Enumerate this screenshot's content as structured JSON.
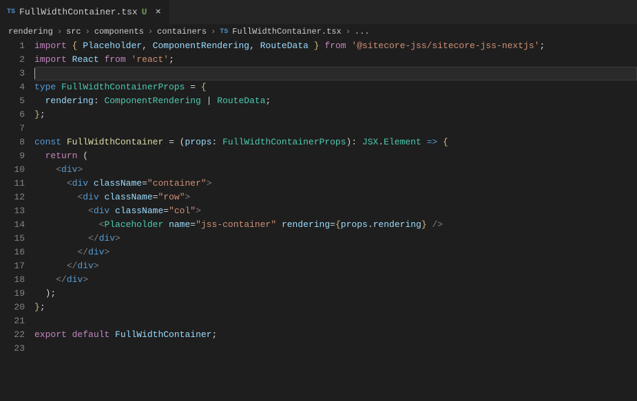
{
  "tab": {
    "icon_text": "TS",
    "filename": "FullWidthContainer.tsx",
    "modified_flag": "U"
  },
  "breadcrumbs": {
    "parts": [
      "rendering",
      "src",
      "components",
      "containers"
    ],
    "file_icon": "TS",
    "file": "FullWidthContainer.tsx",
    "trailing": "..."
  },
  "lines": {
    "nums": [
      "1",
      "2",
      "3",
      "4",
      "5",
      "6",
      "7",
      "8",
      "9",
      "10",
      "11",
      "12",
      "13",
      "14",
      "15",
      "16",
      "17",
      "18",
      "19",
      "20",
      "21",
      "22",
      "23"
    ]
  },
  "code": {
    "l1": {
      "import": "import",
      "open": "{ ",
      "a": "Placeholder",
      "c1": ", ",
      "b": "ComponentRendering",
      "c2": ", ",
      "c": "RouteData",
      "close": " }",
      "from": "from",
      "str": "'@sitecore-jss/sitecore-jss-nextjs'",
      "semi": ";"
    },
    "l2": {
      "import": "import",
      "id": "React",
      "from": "from",
      "str": "'react'",
      "semi": ";"
    },
    "l4": {
      "type": "type",
      "name": "FullWidthContainerProps",
      "eq": " = ",
      "open": "{"
    },
    "l5": {
      "indent": "  ",
      "field": "rendering",
      "colon": ": ",
      "t1": "ComponentRendering",
      "pipe": " | ",
      "t2": "RouteData",
      "semi": ";"
    },
    "l6": {
      "close": "}",
      "semi": ";"
    },
    "l8": {
      "const": "const",
      "fn": "FullWidthContainer",
      "eq": " = (",
      "param": "props",
      "colon": ": ",
      "pty": "FullWidthContainerProps",
      "paren": "): ",
      "rty1": "JSX",
      "dot": ".",
      "rty2": "Element",
      "arrow": " => ",
      "open": "{"
    },
    "l9": {
      "indent": "  ",
      "return": "return",
      "paren": " ("
    },
    "l10": {
      "indent": "    ",
      "o": "<",
      "tag": "div",
      "c": ">"
    },
    "l11": {
      "indent": "      ",
      "o": "<",
      "tag": "div",
      "sp": " ",
      "attr": "className",
      "eq": "=",
      "val": "\"container\"",
      "c": ">"
    },
    "l12": {
      "indent": "        ",
      "o": "<",
      "tag": "div",
      "sp": " ",
      "attr": "className",
      "eq": "=",
      "val": "\"row\"",
      "c": ">"
    },
    "l13": {
      "indent": "          ",
      "o": "<",
      "tag": "div",
      "sp": " ",
      "attr": "className",
      "eq": "=",
      "val": "\"col\"",
      "c": ">"
    },
    "l14": {
      "indent": "            ",
      "o": "<",
      "comp": "Placeholder",
      "sp": " ",
      "a1": "name",
      "eq1": "=",
      "v1": "\"jss-container\"",
      "sp2": " ",
      "a2": "rendering",
      "eq2": "=",
      "bo": "{",
      "expr1": "props",
      "dot": ".",
      "expr2": "rendering",
      "bc": "}",
      "sp3": " ",
      "c": "/>"
    },
    "l15": {
      "indent": "          ",
      "o": "</",
      "tag": "div",
      "c": ">"
    },
    "l16": {
      "indent": "        ",
      "o": "</",
      "tag": "div",
      "c": ">"
    },
    "l17": {
      "indent": "      ",
      "o": "</",
      "tag": "div",
      "c": ">"
    },
    "l18": {
      "indent": "    ",
      "o": "</",
      "tag": "div",
      "c": ">"
    },
    "l19": {
      "indent": "  ",
      "paren": ");"
    },
    "l20": {
      "close": "}",
      "semi": ";"
    },
    "l22": {
      "export": "export",
      "default": "default",
      "name": "FullWidthContainer",
      "semi": ";"
    }
  }
}
